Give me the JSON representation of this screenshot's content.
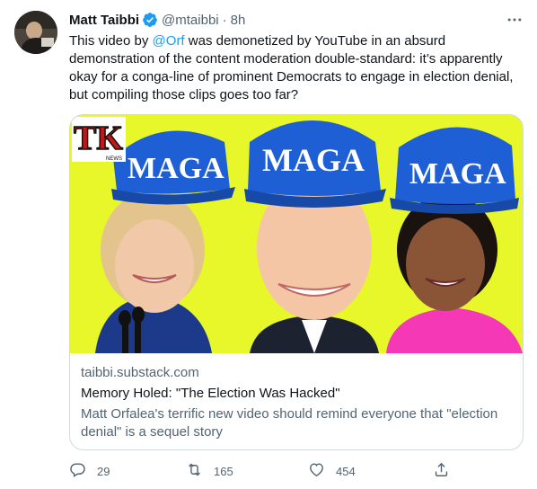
{
  "tweet": {
    "author_name": "Matt Taibbi",
    "handle": "@mtaibbi",
    "separator": "·",
    "time": "8h",
    "body_before": "This video by ",
    "mention": "@Orf",
    "body_after": " was demonetized by YouTube in an absurd demonstration of the content moderation double-standard: it’s apparently okay for a conga-line of prominent Democrats to engage in election denial, but compiling those clips goes too far?"
  },
  "card": {
    "logo_text": "TK",
    "logo_subtext": "NEWS",
    "hat_text": "MAGA",
    "domain": "taibbi.substack.com",
    "title": "Memory Holed: \"The Election Was Hacked\"",
    "description": "Matt Orfalea's terrific new video should remind everyone that \"election denial\" is a sequel story"
  },
  "actions": {
    "reply_count": "29",
    "retweet_count": "165",
    "like_count": "454"
  },
  "colors": {
    "accent": "#1d9bf0",
    "text_primary": "#0f1419",
    "text_secondary": "#536471",
    "border": "#cfd9de",
    "image_background": "#e8f72a",
    "hat_blue": "#1f5fd6"
  },
  "icons": {
    "verified": "verified-badge-icon",
    "more": "more-horizontal-icon",
    "reply": "reply-icon",
    "retweet": "retweet-icon",
    "like": "heart-icon",
    "share": "share-icon"
  }
}
